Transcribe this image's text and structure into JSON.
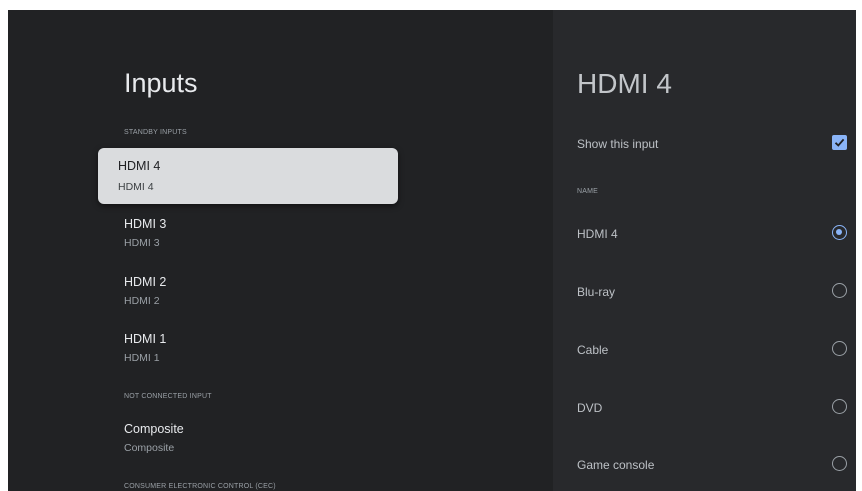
{
  "left": {
    "title": "Inputs",
    "standby_label": "STANDBY INPUTS",
    "standby_items": [
      {
        "primary": "HDMI 4",
        "secondary": "HDMI 4"
      },
      {
        "primary": "HDMI 3",
        "secondary": "HDMI 3"
      },
      {
        "primary": "HDMI 2",
        "secondary": "HDMI 2"
      },
      {
        "primary": "HDMI 1",
        "secondary": "HDMI 1"
      }
    ],
    "not_connected_label": "NOT CONNECTED INPUT",
    "not_connected_items": [
      {
        "primary": "Composite",
        "secondary": "Composite"
      }
    ],
    "cec_label": "CONSUMER ELECTRONIC CONTROL (CEC)"
  },
  "right": {
    "title": "HDMI 4",
    "show_input_label": "Show this input",
    "show_input_checked": true,
    "name_label": "NAME",
    "options": [
      {
        "label": "HDMI 4",
        "selected": true
      },
      {
        "label": "Blu-ray",
        "selected": false
      },
      {
        "label": "Cable",
        "selected": false
      },
      {
        "label": "DVD",
        "selected": false
      },
      {
        "label": "Game console",
        "selected": false
      }
    ]
  },
  "colors": {
    "accent": "#8ab4f8",
    "focused_item_bg": "#dadcde",
    "left_panel_bg": "#212224",
    "right_panel_bg": "#28292c"
  }
}
